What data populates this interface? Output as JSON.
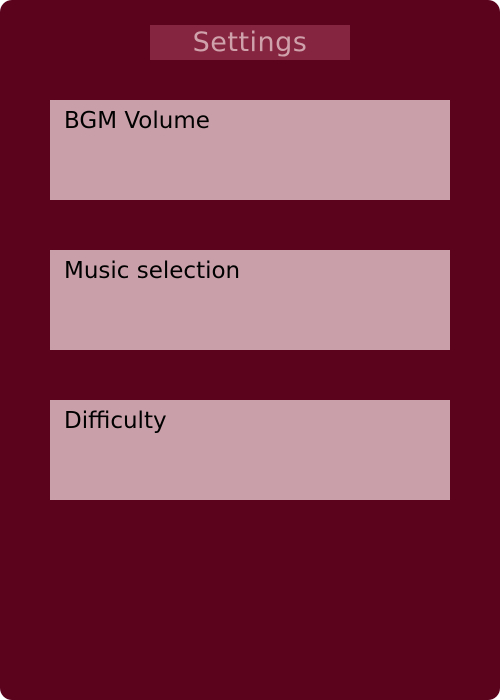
{
  "colors": {
    "background": "#5b021d",
    "title_bar": "#86253f",
    "title_text": "#cfa1ab",
    "setting_box": "#c9a0a9",
    "setting_text": "#000000"
  },
  "screen": {
    "title": "Settings"
  },
  "settings": [
    {
      "label": "BGM Volume"
    },
    {
      "label": "Music selection"
    },
    {
      "label": "Difficulty"
    }
  ]
}
